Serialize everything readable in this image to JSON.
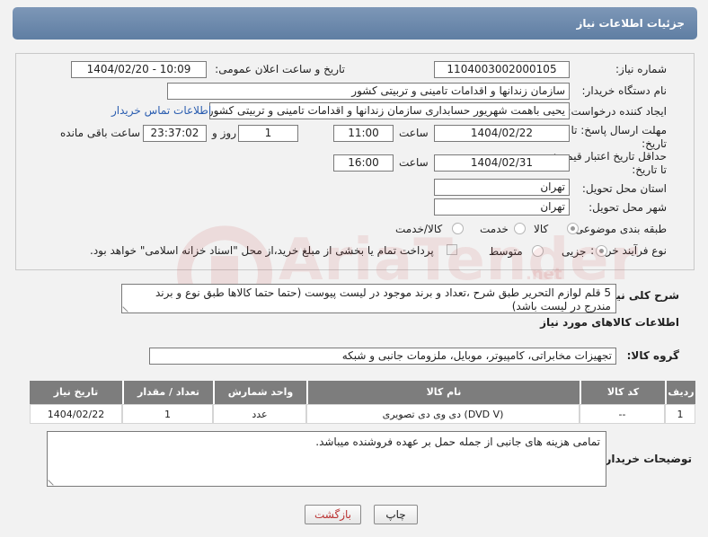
{
  "header": {
    "title": "جزئیات اطلاعات نیاز"
  },
  "form": {
    "need_number_label": "شماره نیاز:",
    "need_number": "1104003002000105",
    "announce_datetime_label": "تاریخ و ساعت اعلان عمومی:",
    "announce_datetime": "1404/02/20 - 10:09",
    "buyer_org_label": "نام دستگاه خریدار:",
    "buyer_org": "سازمان زندانها و اقدامات تامینی و تربیتی کشور",
    "requester_label": "ایجاد کننده درخواست:",
    "requester": "یحیی باهمت شهریور حسابداری سازمان زندانها و اقدامات تامینی و تربیتی کشور",
    "buyer_contact_link": "اطلاعات تماس خریدار",
    "reply_deadline_label": "مهلت ارسال پاسخ: تا تاریخ:",
    "reply_date": "1404/02/22",
    "time_label": "ساعت",
    "reply_time": "11:00",
    "days_value": "1",
    "days_label": "روز و",
    "remaining_time": "23:37:02",
    "remaining_label": "ساعت باقی مانده",
    "price_validity_label": "حداقل تاریخ اعتبار قیمت: تا تاریخ:",
    "price_date": "1404/02/31",
    "price_time_label": "ساعت",
    "price_time": "16:00",
    "delivery_province_label": "استان محل تحویل:",
    "delivery_province": "تهران",
    "delivery_city_label": "شهر محل تحویل:",
    "delivery_city": "تهران",
    "category_label": "طبقه بندی موضوعی:",
    "category_options": [
      "کالا",
      "خدمت",
      "کالا/خدمت"
    ],
    "category_selected": "کالا",
    "purchase_process_label": "نوع فرآیند خرید :",
    "purchase_options": [
      "جزیی",
      "متوسط"
    ],
    "purchase_selected": "جزیی",
    "payment_note": "پرداخت تمام یا بخشی از مبلغ خرید،از محل \"اسناد خزانه اسلامی\" خواهد بود."
  },
  "description": {
    "label": "شرح کلی نیاز:",
    "text": "5 قلم لوازم التحریر طبق شرح ،تعداد و برند موجود در لیست پیوست (حتما حتما کالاها طبق نوع و برند مندرج در لیست باشد)"
  },
  "goods": {
    "section_title": "اطلاعات کالاهای مورد نیاز",
    "group_label": "گروه کالا:",
    "group_value": "تجهیزات مخابراتی، کامپیوتر، موبایل، ملزومات جانبی و شبکه",
    "columns": [
      "ردیف",
      "کد کالا",
      "نام کالا",
      "واحد شمارش",
      "تعداد / مقدار",
      "تاریخ نیاز"
    ],
    "rows": [
      [
        "1",
        "--",
        "دی وی دی تصویری (DVD V)",
        "عدد",
        "1",
        "1404/02/22"
      ]
    ]
  },
  "buyer_notes": {
    "label": "توضیحات خریدار:",
    "text": "تمامی هزینه های جانبی از جمله حمل بر عهده فروشنده میباشد."
  },
  "buttons": {
    "print": "چاپ",
    "back": "بازگشت"
  },
  "watermark": {
    "brand": "AriaTender",
    "sub": ".net"
  },
  "colors": {
    "header": "#6f8bb0",
    "table_header": "#7d7d7d",
    "back_button_text": "#b33"
  }
}
